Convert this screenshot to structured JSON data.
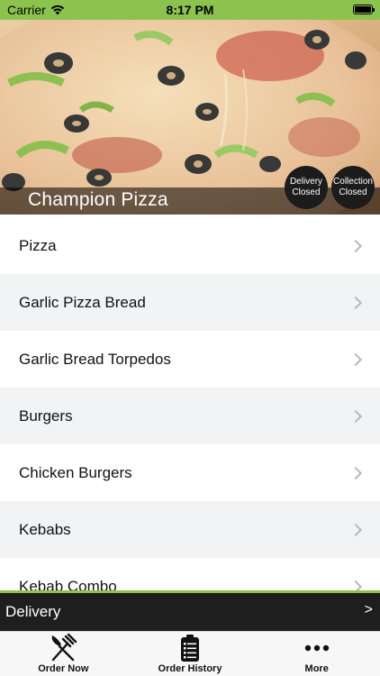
{
  "status_bar": {
    "carrier": "Carrier",
    "time": "8:17 PM"
  },
  "hero": {
    "store_name": "Champion Pizza",
    "delivery_badge": {
      "line1": "Delivery",
      "line2": "Closed"
    },
    "collection_badge": {
      "line1": "Collection",
      "line2": "Closed"
    }
  },
  "categories": [
    {
      "label": "Pizza"
    },
    {
      "label": "Garlic Pizza Bread"
    },
    {
      "label": "Garlic Bread Torpedos"
    },
    {
      "label": "Burgers"
    },
    {
      "label": "Chicken Burgers"
    },
    {
      "label": "Kebabs"
    },
    {
      "label": "Kebab Combo"
    }
  ],
  "delivery_bar": {
    "label": "Delivery",
    "arrow": ">"
  },
  "tabs": [
    {
      "label": "Order Now",
      "icon": "fork-knife-icon"
    },
    {
      "label": "Order History",
      "icon": "clipboard-icon"
    },
    {
      "label": "More",
      "icon": "more-dots-icon"
    }
  ],
  "colors": {
    "accent_green": "#8cc34f",
    "dark_bar": "#1e1e1e",
    "badge_bg": "#1c1c1c",
    "alt_row": "#f2f3f5"
  }
}
